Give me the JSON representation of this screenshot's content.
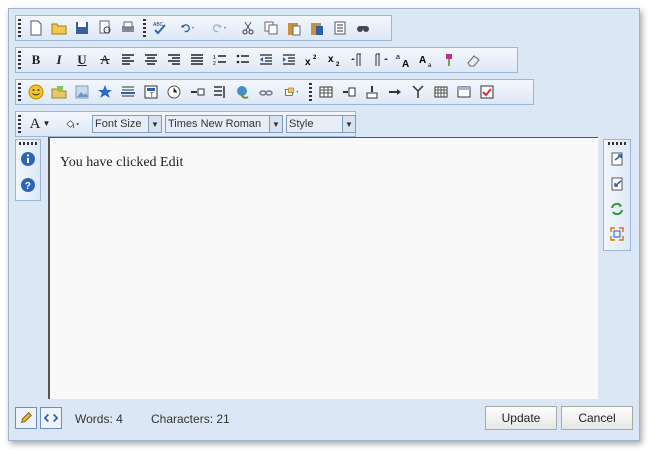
{
  "toolbar": {
    "font_size_label": "Font Size",
    "font_name_label": "Times New Roman",
    "style_label": "Style",
    "bold": "B",
    "italic": "I",
    "underline": "U",
    "strike": "A",
    "text_color": "A"
  },
  "content": {
    "text": "You have clicked Edit"
  },
  "status": {
    "words_label": "Words:",
    "words_value": "4",
    "chars_label": "Characters:",
    "chars_value": "21",
    "update_label": "Update",
    "cancel_label": "Cancel"
  },
  "colors": {
    "frame": "#dbe7f5",
    "accent": "#2f5fa8",
    "border": "#9db6d6"
  }
}
